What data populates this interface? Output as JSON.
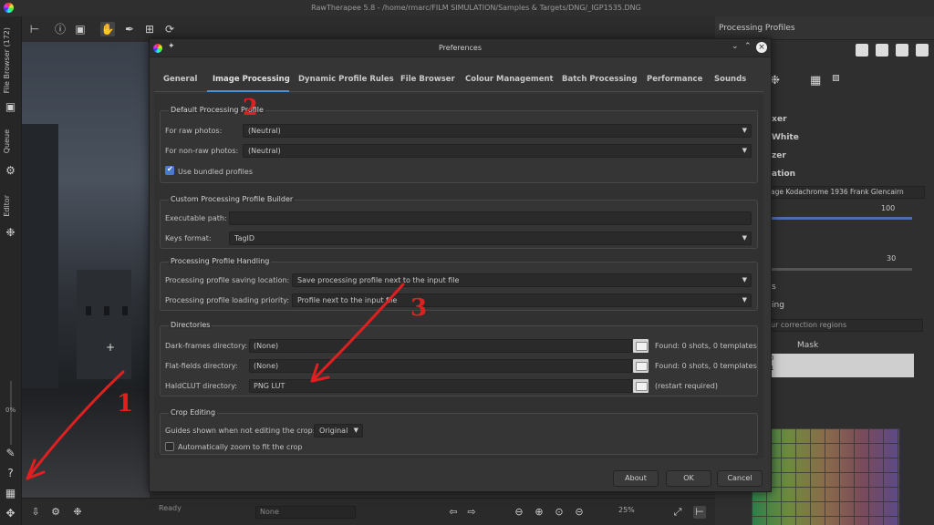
{
  "window": {
    "title": "RawTherapee 5.8 - /home/rmarc/FILM SIMULATION/Samples & Targets/DNG/_IGP1535.DNG",
    "status": "Ready",
    "zoom": "25%",
    "zoom_left": "0%",
    "none_select": "None"
  },
  "left_tabs": {
    "file_browser": "File Browser (172)",
    "queue": "Queue",
    "editor": "Editor"
  },
  "right_panel": {
    "title": "Processing Profiles",
    "items": [
      "lixer",
      "White",
      "zer",
      "ation"
    ],
    "film_profile": "age Kodachrome 1936 Frank Glencairn",
    "value1": "100",
    "value2": "30",
    "region_text": "ur correction regions",
    "mask_label": "Mask",
    "misc1": "s",
    "misc2": "ing",
    "small1": "0",
    "small2": "1"
  },
  "dialog": {
    "title": "Preferences",
    "tabs": [
      "General",
      "Image Processing",
      "Dynamic Profile Rules",
      "File Browser",
      "Colour Management",
      "Batch Processing",
      "Performance",
      "Sounds"
    ],
    "active_tab": "Image Processing",
    "default_profile": {
      "title": "Default Processing Profile",
      "raw_label": "For raw photos:",
      "raw_value": "(Neutral)",
      "nonraw_label": "For non-raw photos:",
      "nonraw_value": "(Neutral)",
      "bundled_label": "Use bundled profiles",
      "bundled_checked": true
    },
    "custom_builder": {
      "title": "Custom Processing Profile Builder",
      "exec_label": "Executable path:",
      "exec_value": "",
      "keys_label": "Keys format:",
      "keys_value": "TagID"
    },
    "handling": {
      "title": "Processing Profile Handling",
      "saving_label": "Processing profile saving location:",
      "saving_value": "Save processing profile next to the input file",
      "loading_label": "Processing profile loading priority:",
      "loading_value": "Profile next to the input file"
    },
    "directories": {
      "title": "Directories",
      "dark_label": "Dark-frames directory:",
      "dark_value": "(None)",
      "dark_found": "Found: 0 shots, 0 templates",
      "flat_label": "Flat-fields directory:",
      "flat_value": "(None)",
      "flat_found": "Found: 0 shots, 0 templates",
      "hald_label": "HaldCLUT directory:",
      "hald_value": "PNG LUT",
      "hald_note": "(restart required)"
    },
    "crop": {
      "title": "Crop Editing",
      "guides_label": "Guides shown when not editing the crop:",
      "guides_value": "Original",
      "autozoom_label": "Automatically zoom to fit the crop",
      "autozoom_checked": false
    },
    "buttons": {
      "about": "About",
      "ok": "OK",
      "cancel": "Cancel"
    }
  },
  "annotations": {
    "one": "1",
    "two": "2",
    "three": "3",
    "color": "#e02020"
  }
}
